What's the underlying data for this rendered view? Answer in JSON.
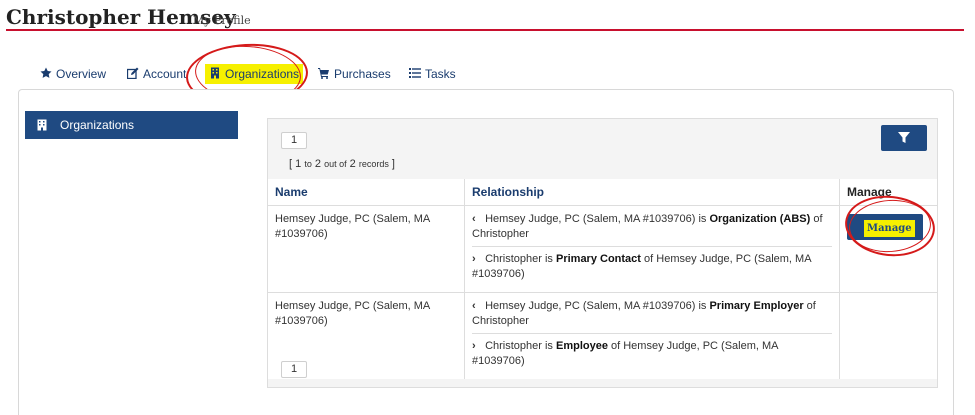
{
  "header": {
    "name": "Christopher Hemsey",
    "subtitle": "My Profile"
  },
  "tabs": [
    {
      "label": "Overview",
      "icon": "star-icon"
    },
    {
      "label": "Account",
      "icon": "edit-icon"
    },
    {
      "label": "Organizations",
      "icon": "building-icon",
      "active": true
    },
    {
      "label": "Purchases",
      "icon": "cart-icon"
    },
    {
      "label": "Tasks",
      "icon": "list-icon"
    }
  ],
  "sidebar": {
    "items": [
      {
        "label": "Organizations",
        "icon": "building-icon"
      }
    ]
  },
  "pager": {
    "top_page": "1",
    "bottom_page": "1"
  },
  "records": {
    "open": "[ ",
    "from": "1",
    "to_word": "to",
    "to": "2",
    "outof": "out of",
    "total": "2",
    "records_word": "records",
    "close": " ]"
  },
  "table": {
    "headers": {
      "name": "Name",
      "relationship": "Relationship",
      "manage": "Manage"
    },
    "rows": [
      {
        "name": "Hemsey Judge, PC (Salem, MA #1039706)",
        "rels": [
          {
            "chev": "‹",
            "pre": "Hemsey Judge, PC (Salem, MA #1039706) is ",
            "bold": "Organization (ABS)",
            "post": " of Christopher"
          },
          {
            "chev": "›",
            "pre": "Christopher is ",
            "bold": "Primary Contact",
            "post": " of Hemsey Judge, PC (Salem, MA #1039706)"
          }
        ],
        "manage_label": "Manage"
      },
      {
        "name": "Hemsey Judge, PC (Salem, MA #1039706)",
        "rels": [
          {
            "chev": "‹",
            "pre": "Hemsey Judge, PC (Salem, MA #1039706) is ",
            "bold": "Primary Employer",
            "post": " of Christopher"
          },
          {
            "chev": "›",
            "pre": "Christopher is ",
            "bold": "Employee",
            "post": " of Hemsey Judge, PC (Salem, MA #1039706)"
          }
        ]
      }
    ]
  },
  "colors": {
    "accent_red": "#c8102e",
    "nav_blue": "#1f4a82",
    "highlight": "#f6f000",
    "annotation_red": "#d51a1a"
  }
}
